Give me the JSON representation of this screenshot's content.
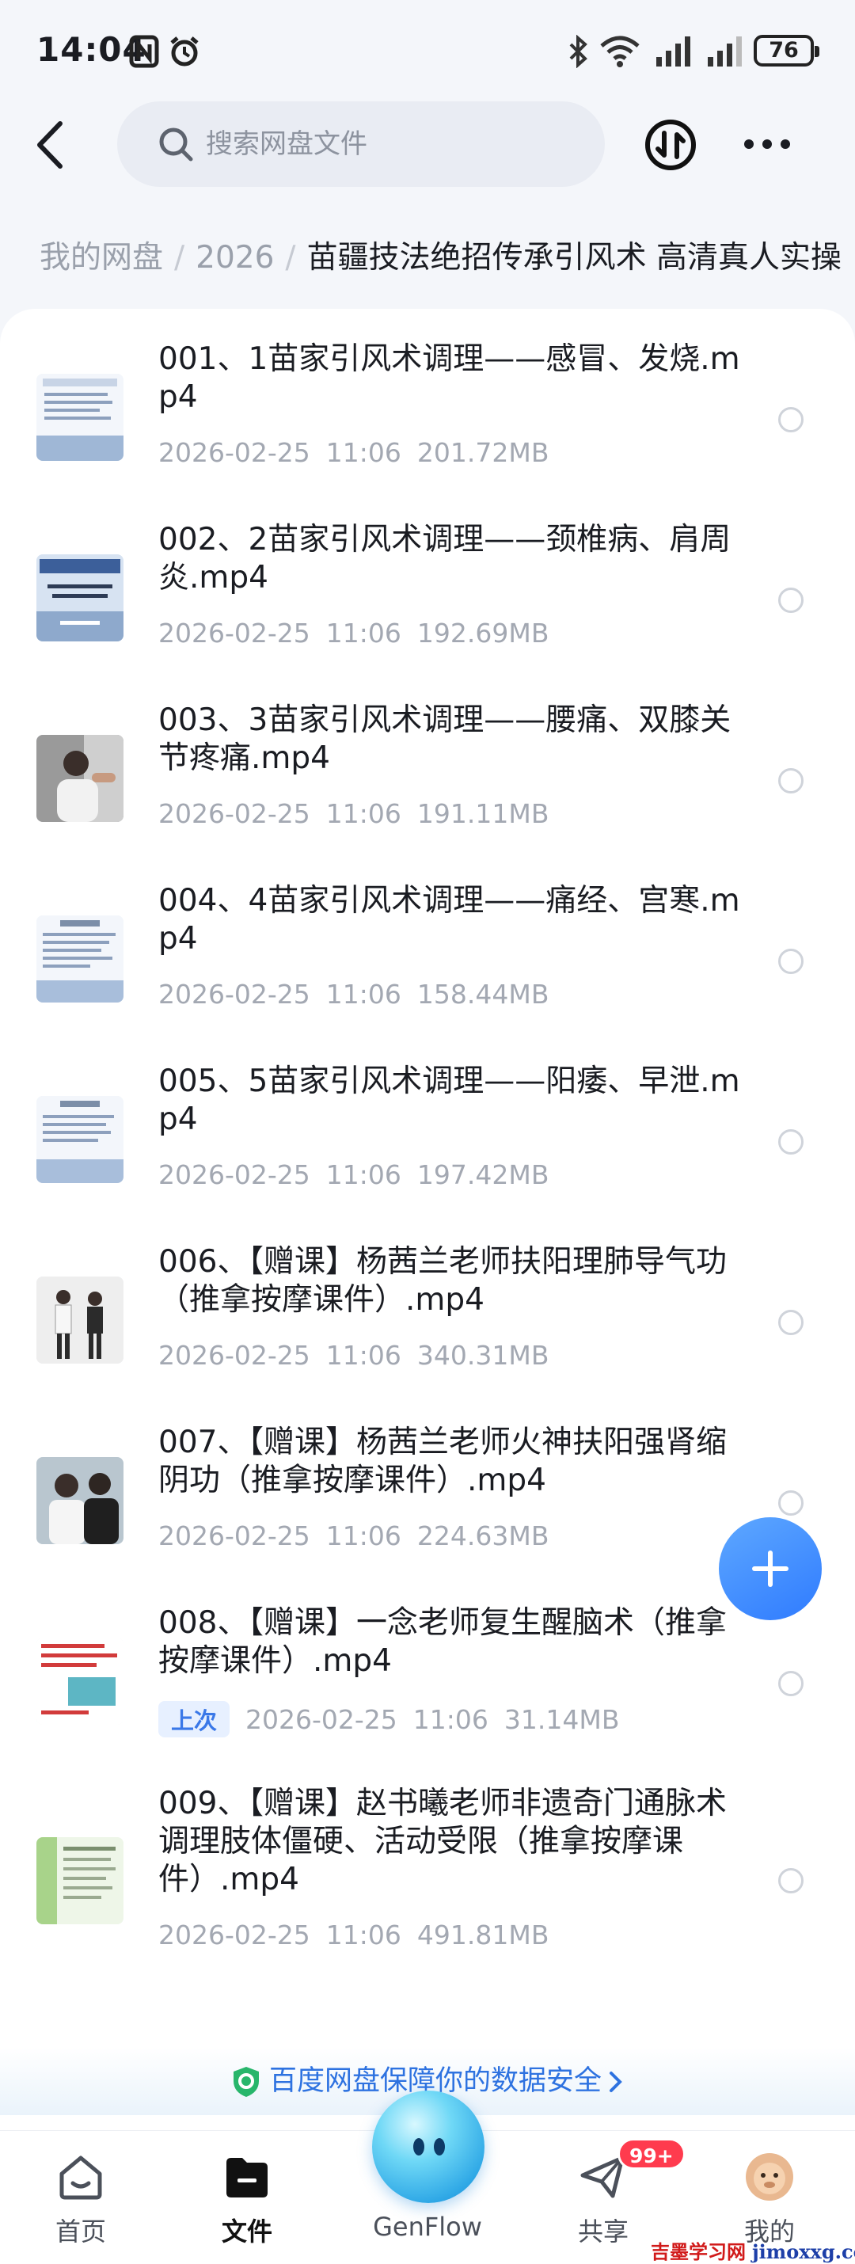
{
  "status_bar": {
    "time": "14:04",
    "battery": "76",
    "icons": [
      "nfc-icon",
      "alarm-icon",
      "bluetooth-icon",
      "wifi-icon",
      "signal-icon",
      "signal-icon"
    ]
  },
  "header": {
    "search_placeholder": "搜索网盘文件",
    "icons": [
      "back-icon",
      "search-icon",
      "transfer-icon",
      "more-icon"
    ]
  },
  "breadcrumb": {
    "root": "我的网盘",
    "level1": "2026",
    "current": "苗疆技法绝招传承引风术 高清真人实操"
  },
  "files": [
    {
      "name": "001、1苗家引风术调理——感冒、发烧.mp4",
      "date": "2026-02-25",
      "time": "11:06",
      "size": "201.72MB",
      "thumb": "doc"
    },
    {
      "name": "002、2苗家引风术调理——颈椎病、肩周炎.mp4",
      "date": "2026-02-25",
      "time": "11:06",
      "size": "192.69MB",
      "thumb": "slide"
    },
    {
      "name": "003、3苗家引风术调理——腰痛、双膝关节疼痛.mp4",
      "date": "2026-02-25",
      "time": "11:06",
      "size": "191.11MB",
      "thumb": "person"
    },
    {
      "name": "004、4苗家引风术调理——痛经、宫寒.mp4",
      "date": "2026-02-25",
      "time": "11:06",
      "size": "158.44MB",
      "thumb": "doc"
    },
    {
      "name": "005、5苗家引风术调理——阳痿、早泄.mp4",
      "date": "2026-02-25",
      "time": "11:06",
      "size": "197.42MB",
      "thumb": "doc"
    },
    {
      "name": "006、【赠课】杨茜兰老师扶阳理肺导气功（推拿按摩课件）.mp4",
      "date": "2026-02-25",
      "time": "11:06",
      "size": "340.31MB",
      "thumb": "people"
    },
    {
      "name": "007、【赠课】杨茜兰老师火神扶阳强肾缩阴功（推拿按摩课件）.mp4",
      "date": "2026-02-25",
      "time": "11:06",
      "size": "224.63MB",
      "thumb": "group"
    },
    {
      "name": "008、【赠课】一念老师复生醒脑术（推拿按摩课件）.mp4",
      "date": "2026-02-25",
      "time": "11:06",
      "size": "31.14MB",
      "thumb": "redtext",
      "badge": "上次"
    },
    {
      "name": "009、【赠课】赵书曦老师非遗奇门通脉术调理肢体僵硬、活动受限（推拿按摩课件）.mp4",
      "date": "2026-02-25",
      "time": "11:06",
      "size": "491.81MB",
      "thumb": "green"
    }
  ],
  "fab": {
    "icon": "plus-icon"
  },
  "security_banner": "百度网盘保障你的数据安全",
  "tabbar": {
    "tabs": [
      {
        "label": "首页",
        "icon": "home-icon"
      },
      {
        "label": "文件",
        "icon": "folder-icon",
        "active": true
      },
      {
        "label": "GenFlow",
        "icon": "genflow-icon"
      },
      {
        "label": "共享",
        "icon": "share-icon"
      },
      {
        "label": "我的",
        "icon": "avatar-icon"
      }
    ],
    "share_badge": "99+"
  },
  "watermark": {
    "text": "吉墨学习网",
    "url": "jimoxxg.com"
  },
  "colors": {
    "accent": "#3a78e8",
    "badge": "#ff3b4e",
    "meta": "#a3a8b2"
  }
}
